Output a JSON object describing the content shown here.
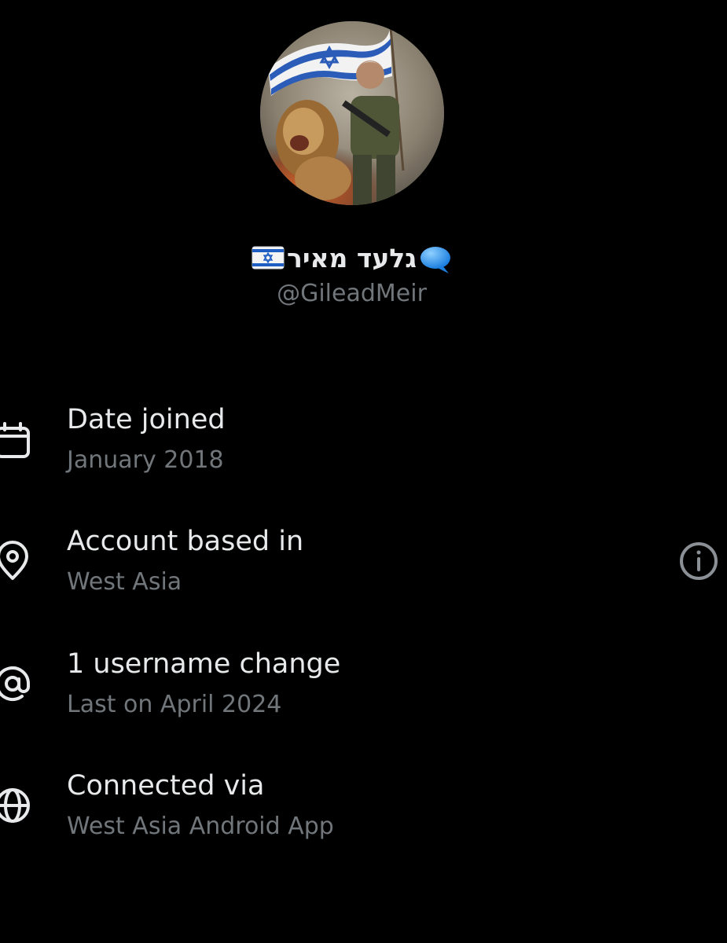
{
  "profile": {
    "display_name": "גלעד מאיר",
    "handle": "@GileadMeir",
    "flag_icon": "israel-flag-icon",
    "badge_icon": "speech-bubble-icon"
  },
  "about": [
    {
      "icon": "calendar-icon",
      "title": "Date joined",
      "subtitle": "January 2018"
    },
    {
      "icon": "location-pin-icon",
      "title": "Account based in",
      "subtitle": "West Asia",
      "action_icon": "info-icon"
    },
    {
      "icon": "at-sign-icon",
      "title": "1 username change",
      "subtitle": "Last on April 2024"
    },
    {
      "icon": "globe-icon",
      "title": "Connected via",
      "subtitle": "West Asia Android App"
    }
  ],
  "colors": {
    "background": "#000000",
    "primary_text": "#e7e9ea",
    "secondary_text": "#71767b",
    "icon": "#e7e9ea",
    "info_icon": "#8b9096"
  }
}
